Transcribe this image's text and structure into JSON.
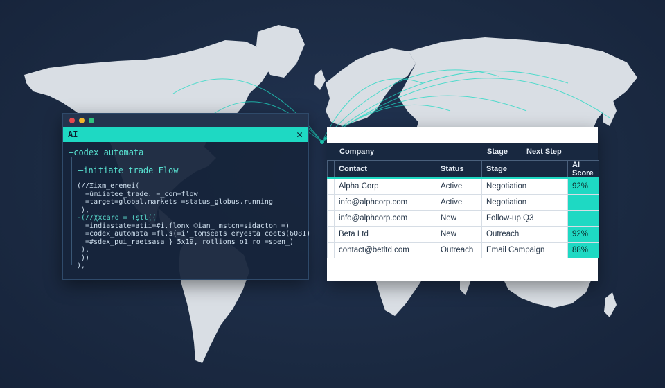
{
  "code_window": {
    "tab_label": "AI",
    "close_glyph": "✕",
    "lines": [
      "—codex_automata",
      "—initiate_trade_Flow",
      "(//Ξixm_erenei(",
      "  =űmiiatee_trade. =_com=flow",
      "  =target=global.markets =status_globus.running",
      " ),",
      "-(//Ꭓxcaro = (ṣtl((",
      "  =indiastate=atii=#i.flonx ©ian_ mstcn=sidacton =)",
      "  =codex_automata =fl.s(=i'_tomseats eryesta coets(6081)",
      "  =#sdex_pui_raetsasa } 5x19, rotlions o1 ro =spen_)",
      " ),",
      " ))",
      "),"
    ]
  },
  "crm_window": {
    "subheader": {
      "company": "Company",
      "stage": "Stage",
      "next_step": "Next Step"
    },
    "columns": [
      "Contact",
      "Status",
      "Stage",
      "AI Score"
    ],
    "rows": [
      {
        "contact": "Alpha Corp",
        "status": "Active",
        "stage": "Negotiation",
        "score": "92%"
      },
      {
        "contact": "info@alphcorp.com",
        "status": "Active",
        "stage": "Negotiation",
        "score": ""
      },
      {
        "contact": "info@alphcorp.com",
        "status": "New",
        "stage": "Follow-up Q3",
        "score": ""
      },
      {
        "contact": "Beta Ltd",
        "status": "New",
        "stage": "Outreach",
        "score": "92%"
      },
      {
        "contact": "contact@betltd.com",
        "status": "Outreach",
        "stage": "Email Campaign",
        "score": "88%"
      }
    ]
  },
  "colors": {
    "background": "#1b2a42",
    "map_land": "#d9dee4",
    "accent": "#1ed9c3",
    "header": "#182840"
  }
}
